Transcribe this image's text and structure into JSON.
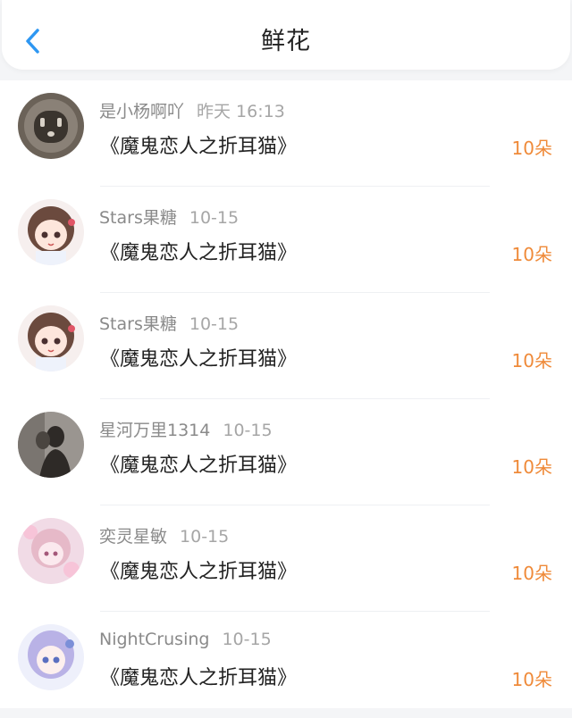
{
  "header": {
    "title": "鲜花",
    "back_icon": "chevron-left-icon",
    "accent_color": "#2e97f2"
  },
  "amount_color": "#ef8a39",
  "records": [
    {
      "user": "是小杨啊吖",
      "time": "昨天 16:13",
      "book": "《魔鬼恋人之折耳猫》",
      "amount": "10朵",
      "avatar": "outlet-photo"
    },
    {
      "user": "Stars果糖",
      "time": "10-15",
      "book": "《魔鬼恋人之折耳猫》",
      "amount": "10朵",
      "avatar": "anime-girl-brown-hair"
    },
    {
      "user": "Stars果糖",
      "time": "10-15",
      "book": "《魔鬼恋人之折耳猫》",
      "amount": "10朵",
      "avatar": "anime-girl-brown-hair"
    },
    {
      "user": "星河万里1314",
      "time": "10-15",
      "book": "《魔鬼恋人之折耳猫》",
      "amount": "10朵",
      "avatar": "silhouette-photo"
    },
    {
      "user": "奕灵星敏",
      "time": "10-15",
      "book": "《魔鬼恋人之折耳猫》",
      "amount": "10朵",
      "avatar": "anime-girl-pink"
    },
    {
      "user": "NightCrusing",
      "time": "10-15",
      "book": "《魔鬼恋人之折耳猫》",
      "amount": "10朵",
      "avatar": "anime-girl-lavender-hair"
    }
  ]
}
